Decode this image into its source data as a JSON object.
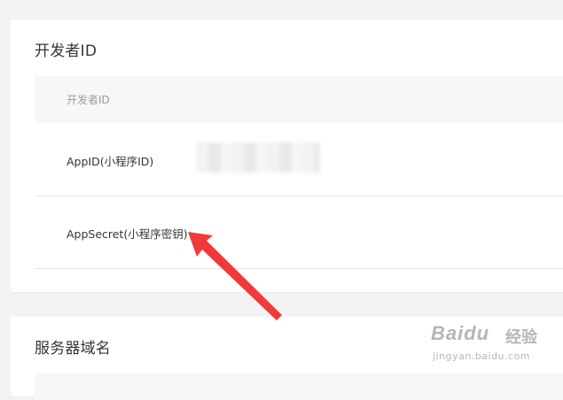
{
  "developer_card": {
    "title": "开发者ID",
    "table_header": "开发者ID",
    "rows": [
      {
        "label": "AppID(小程序ID)"
      },
      {
        "label": "AppSecret(小程序密钥)"
      }
    ]
  },
  "server_card": {
    "title": "服务器域名"
  },
  "annotation": {
    "color": "#f03a3a"
  },
  "watermark": {
    "brand": "Baidu",
    "sub": "经验",
    "url": "jingyan.baidu.com"
  }
}
